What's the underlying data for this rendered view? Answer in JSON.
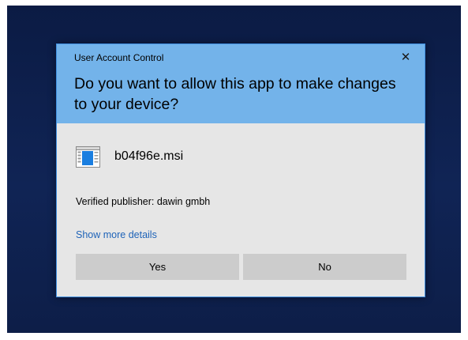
{
  "dialog": {
    "window_title": "User Account Control",
    "close_glyph": "✕",
    "question": "Do you want to allow this app to make changes to your device?",
    "app_name": "b04f96e.msi",
    "app_icon": "installer-package-icon",
    "publisher": "Verified publisher: dawin gmbh",
    "details_link": "Show more details",
    "yes_label": "Yes",
    "no_label": "No"
  },
  "colors": {
    "header": "#73b3ea",
    "body": "#e6e6e6",
    "buttons": "#cccccc",
    "link": "#1e63b8",
    "border": "#3f8fe0",
    "desktop": "#102455"
  }
}
